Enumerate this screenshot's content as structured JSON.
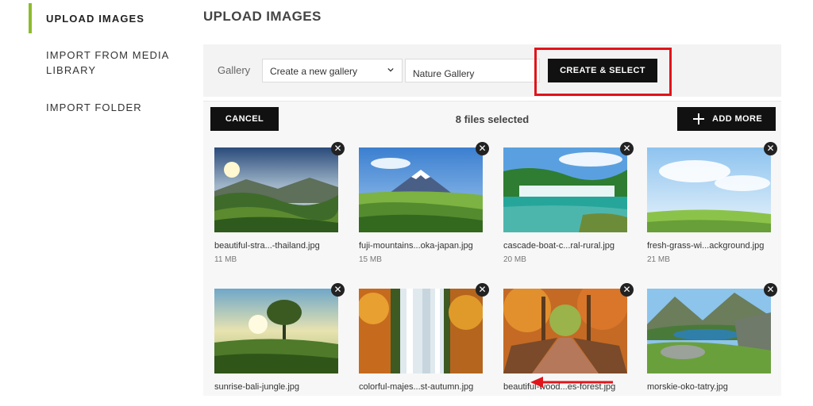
{
  "sidebar": {
    "items": [
      {
        "label": "UPLOAD IMAGES"
      },
      {
        "label": "IMPORT FROM MEDIA LIBRARY"
      },
      {
        "label": "IMPORT FOLDER"
      }
    ]
  },
  "main": {
    "title": "UPLOAD IMAGES"
  },
  "gallery": {
    "label": "Gallery",
    "select_value": "Create a new gallery",
    "name_value": "Nature Gallery",
    "create_label": "CREATE & SELECT"
  },
  "toolbar": {
    "cancel_label": "CANCEL",
    "selected_text": "8 files selected",
    "add_more_label": "ADD MORE"
  },
  "files": [
    {
      "name": "beautiful-stra...-thailand.jpg",
      "size": "11 MB"
    },
    {
      "name": "fuji-mountains...oka-japan.jpg",
      "size": "15 MB"
    },
    {
      "name": "cascade-boat-c...ral-rural.jpg",
      "size": "20 MB"
    },
    {
      "name": "fresh-grass-wi...ackground.jpg",
      "size": "21 MB"
    },
    {
      "name": "sunrise-bali-jungle.jpg",
      "size": ""
    },
    {
      "name": "colorful-majes...st-autumn.jpg",
      "size": ""
    },
    {
      "name": "beautiful-wood...es-forest.jpg",
      "size": ""
    },
    {
      "name": "morskie-oko-tatry.jpg",
      "size": ""
    }
  ],
  "colors": {
    "accent": "#8dbb2b",
    "button": "#111111",
    "highlight": "#e1141a"
  },
  "icons": {
    "remove": "close-icon",
    "add": "plus-icon",
    "dropdown": "chevron-down-icon"
  }
}
